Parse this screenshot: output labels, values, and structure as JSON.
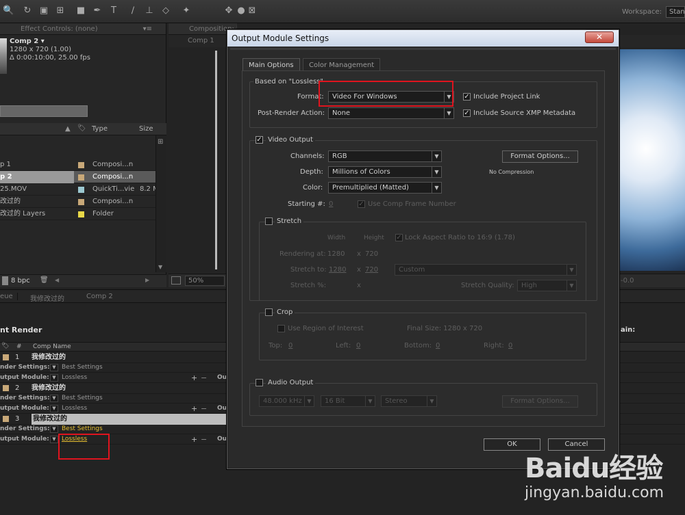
{
  "workspace": {
    "label": "Workspace:",
    "value": "Stan"
  },
  "effect_controls": {
    "title": "Effect Controls: (none)"
  },
  "composition_panel": {
    "title": "Composition: 我修改过的",
    "tab": "Comp 1",
    "zoom": "50%",
    "offset": "-0.0"
  },
  "project": {
    "comp_name": "Comp 2 ▾",
    "comp_size": "1280 x 720 (1.00)",
    "comp_duration": "Δ 0:00:10:00, 25.00 fps",
    "col_type": "Type",
    "col_size": "Size",
    "items": [
      {
        "name": "p 1",
        "type": "Composi...n",
        "size": "",
        "color": "#c8a878"
      },
      {
        "name": "p 2",
        "type": "Composi...n",
        "size": "",
        "color": "#c8a878"
      },
      {
        "name": "25.MOV",
        "type": "QuickTi...vie",
        "size": "8.2 M",
        "color": "#9cc8d0"
      },
      {
        "name": "改过的",
        "type": "Composi...n",
        "size": "",
        "color": "#c8a878"
      },
      {
        "name": "改过的 Layers",
        "type": "Folder",
        "size": "",
        "color": "#e8d848"
      }
    ],
    "bpc": "8 bpc"
  },
  "bottom_tabs": [
    "eue",
    "我修改过的",
    "Comp 2"
  ],
  "render_queue": {
    "title": "nt Render",
    "col_num": "#",
    "col_comp": "Comp Name",
    "right_label": "ain:",
    "render_settings_label": "nder Settings:",
    "output_module_label": "utput Module:",
    "items": [
      {
        "num": "1",
        "comp": "我修改过的",
        "render_settings": "Best Settings",
        "output_module": "Lossless",
        "out": "Ou"
      },
      {
        "num": "2",
        "comp": "我修改过的",
        "render_settings": "Best Settings",
        "output_module": "Lossless",
        "out": "Ou"
      },
      {
        "num": "3",
        "comp": "我修改过的",
        "render_settings": "Best Settings",
        "output_module": "Lossless",
        "out": "Ou"
      }
    ]
  },
  "dialog": {
    "title": "Output Module Settings",
    "close": "✕",
    "tabs": {
      "main": "Main Options",
      "color": "Color Management"
    },
    "based_on": "Based on \"Lossless\"",
    "format_label": "Format:",
    "format_value": "Video For Windows",
    "post_render_label": "Post-Render Action:",
    "post_render_value": "None",
    "include_project_link": "Include Project Link",
    "include_xmp": "Include Source XMP Metadata",
    "video_output": "Video Output",
    "channels_label": "Channels:",
    "channels_value": "RGB",
    "depth_label": "Depth:",
    "depth_value": "Millions of Colors",
    "color_label": "Color:",
    "color_value": "Premultiplied (Matted)",
    "starting_label": "Starting #:",
    "starting_value": "0",
    "use_comp_frame": "Use Comp Frame Number",
    "format_options": "Format Options...",
    "compression": "No Compression",
    "stretch": "Stretch",
    "width_hdr": "Width",
    "height_hdr": "Height",
    "lock_aspect": "Lock Aspect Ratio to 16:9 (1.78)",
    "rendering_at_label": "Rendering at:",
    "rendering_w": "1280",
    "rendering_x": "x",
    "rendering_h": "720",
    "stretch_to_label": "Stretch to:",
    "stretch_w": "1280",
    "stretch_x": "x",
    "stretch_h": "720",
    "stretch_preset": "Custom",
    "stretch_pct_label": "Stretch %:",
    "stretch_pct_x": "x",
    "stretch_quality_label": "Stretch Quality:",
    "stretch_quality": "High",
    "crop": "Crop",
    "use_roi": "Use Region of Interest",
    "final_size": "Final Size: 1280 x 720",
    "top_label": "Top:",
    "top_value": "0",
    "left_label": "Left:",
    "left_value": "0",
    "bottom_label": "Bottom:",
    "bottom_value": "0",
    "right_label": "Right:",
    "right_value": "0",
    "audio_output": "Audio Output",
    "audio_rate": "48.000 kHz",
    "audio_bits": "16 Bit",
    "audio_channels": "Stereo",
    "audio_format_options": "Format Options...",
    "ok": "OK",
    "cancel": "Cancel"
  },
  "watermark": {
    "brand": "Baidu经验",
    "url": "jingyan.baidu.com"
  }
}
